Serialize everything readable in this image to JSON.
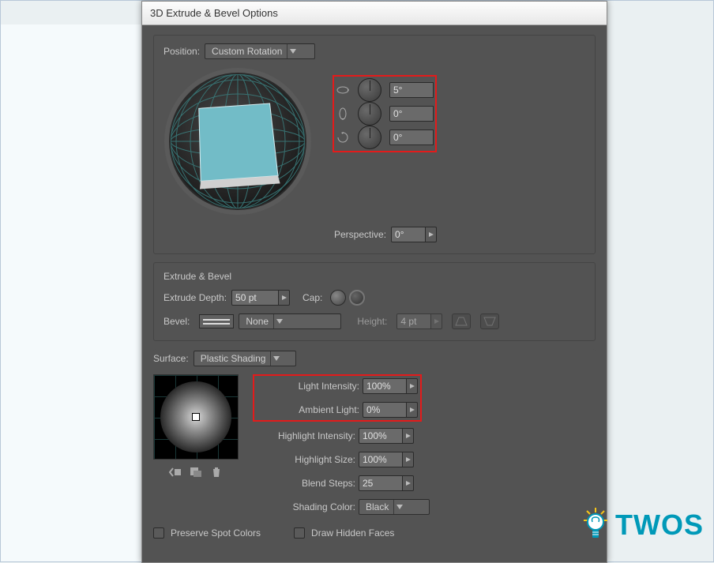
{
  "window": {
    "title": "3D Extrude & Bevel Options"
  },
  "position": {
    "label": "Position:",
    "dropdown": "Custom Rotation",
    "rotX": "5°",
    "rotY": "0°",
    "rotZ": "0°",
    "perspective_label": "Perspective:",
    "perspective": "0°"
  },
  "extrude": {
    "group_label": "Extrude & Bevel",
    "depth_label": "Extrude Depth:",
    "depth": "50 pt",
    "cap_label": "Cap:",
    "bevel_label": "Bevel:",
    "bevel": "None",
    "height_label": "Height:",
    "height": "4 pt"
  },
  "surface": {
    "label": "Surface:",
    "dropdown": "Plastic Shading",
    "light_intensity_label": "Light Intensity:",
    "light_intensity": "100%",
    "ambient_light_label": "Ambient Light:",
    "ambient_light": "0%",
    "highlight_intensity_label": "Highlight Intensity:",
    "highlight_intensity": "100%",
    "highlight_size_label": "Highlight Size:",
    "highlight_size": "100%",
    "blend_steps_label": "Blend Steps:",
    "blend_steps": "25",
    "shading_color_label": "Shading Color:",
    "shading_color": "Black",
    "preserve_spot": "Preserve Spot Colors",
    "draw_hidden": "Draw Hidden Faces"
  },
  "watermark": {
    "text": "TWOS"
  }
}
